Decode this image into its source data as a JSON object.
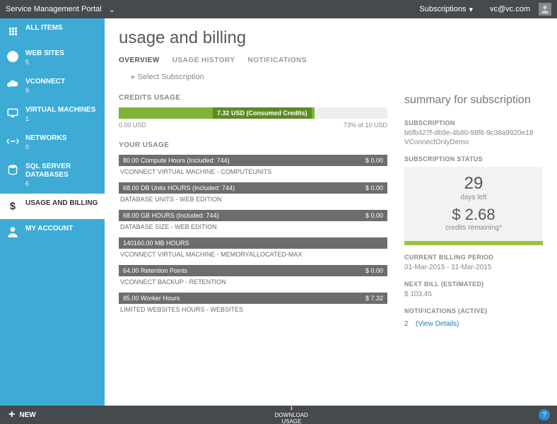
{
  "topbar": {
    "title": "Service Management Portal",
    "subscriptions": "Subscriptions",
    "user": "vc@vc.com"
  },
  "sidebar": {
    "items": [
      {
        "label": "ALL ITEMS",
        "count": ""
      },
      {
        "label": "WEB SITES",
        "count": "5"
      },
      {
        "label": "VCONNECT",
        "count": "9"
      },
      {
        "label": "VIRTUAL MACHINES",
        "count": "1"
      },
      {
        "label": "NETWORKS",
        "count": "0"
      },
      {
        "label": "SQL SERVER DATABASES",
        "count": "6"
      },
      {
        "label": "USAGE AND BILLING",
        "count": ""
      },
      {
        "label": "MY ACCOUNT",
        "count": ""
      }
    ]
  },
  "page": {
    "title": "usage and billing",
    "tabs": [
      "OVERVIEW",
      "USAGE HISTORY",
      "NOTIFICATIONS"
    ],
    "breadcrumb": "Select Subscription"
  },
  "credits": {
    "heading": "CREDITS USAGE",
    "consumed_label": "7.32 USD (Consumed Credits)",
    "min": "0.00 USD",
    "max_label": "73% of 10 USD",
    "percent": 73
  },
  "usage": {
    "heading": "YOUR USAGE",
    "items": [
      {
        "bar": "80.00 Compute Hours (Included: 744)",
        "cost": "$ 0.00",
        "sub": "VCONNECT VIRTUAL MACHINE - COMPUTEUNITS"
      },
      {
        "bar": "68.00 DB Units HOURS (Included: 744)",
        "cost": "$ 0.00",
        "sub": "DATABASE UNITS - WEB EDITION"
      },
      {
        "bar": "68.00 GB HOURS (Included: 744)",
        "cost": "$ 0.00",
        "sub": "DATABASE SIZE - WEB EDITION"
      },
      {
        "bar": "140160.00 MB HOURS",
        "cost": "",
        "sub": "VCONNECT VIRTUAL MACHINE - MEMORYALLOCATED-MAX"
      },
      {
        "bar": "64.00 Retention Points",
        "cost": "$ 0.00",
        "sub": "VCONNECT BACKUP - RETENTION"
      },
      {
        "bar": "85.00 Worker Hours",
        "cost": "$ 7.32",
        "sub": "LIMITED WEBSITES HOURS - WEBSITES"
      }
    ]
  },
  "summary": {
    "title": "summary for subscription",
    "sub_label": "SUBSCRIPTION",
    "sub_id": "b6fb427f-db9e-4b80-98f6-9c38a9920e18",
    "sub_name": "VConnectOnlyDemo",
    "status_label": "SUBSCRIPTION STATUS",
    "days": "29",
    "days_label": "days left",
    "credits": "$ 2.68",
    "credits_label": "credits remaining*",
    "period_label": "CURRENT BILLING PERIOD",
    "period": "01-Mar-2015 - 31-Mar-2015",
    "next_label": "NEXT BILL (ESTIMATED)",
    "next": "$ 103.45",
    "notif_label": "NOTIFICATIONS (ACTIVE)",
    "notif_count": "2",
    "notif_link": "(View Details)"
  },
  "bottom": {
    "new": "NEW",
    "download": "DOWNLOAD\nUSAGE"
  }
}
